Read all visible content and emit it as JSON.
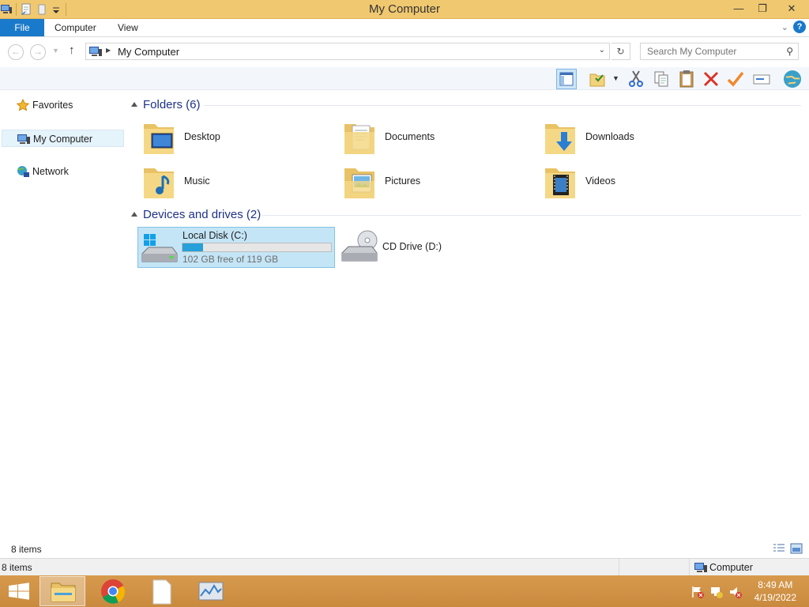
{
  "window": {
    "title": "My Computer"
  },
  "ribbon": {
    "tabs": {
      "file": "File",
      "computer": "Computer",
      "view": "View"
    }
  },
  "address": {
    "location": "My Computer"
  },
  "search": {
    "placeholder": "Search My Computer"
  },
  "nav": {
    "favorites": "Favorites",
    "my_computer": "My Computer",
    "network": "Network"
  },
  "groups": {
    "folders": "Folders (6)",
    "devices": "Devices and drives (2)"
  },
  "folders": [
    {
      "name": "Desktop",
      "icon": "desktop-folder-icon"
    },
    {
      "name": "Documents",
      "icon": "documents-folder-icon"
    },
    {
      "name": "Downloads",
      "icon": "downloads-folder-icon"
    },
    {
      "name": "Music",
      "icon": "music-folder-icon"
    },
    {
      "name": "Pictures",
      "icon": "pictures-folder-icon"
    },
    {
      "name": "Videos",
      "icon": "videos-folder-icon"
    }
  ],
  "drives": [
    {
      "name": "Local Disk (C:)",
      "free_text": "102 GB free of 119 GB",
      "used_fraction": 0.14,
      "selected": true
    },
    {
      "name": "CD Drive (D:)"
    }
  ],
  "status": {
    "item_count": "8 items",
    "bar_count": "8 items",
    "zone": "Computer"
  },
  "taskbar": {
    "time": "8:49 AM",
    "date": "4/19/2022"
  },
  "colors": {
    "accent": "#1979ca",
    "titlebar": "#f0c870",
    "taskbar": "#d79a4d",
    "selection": "#c4e5f6",
    "drive_fill": "#26a0da"
  }
}
